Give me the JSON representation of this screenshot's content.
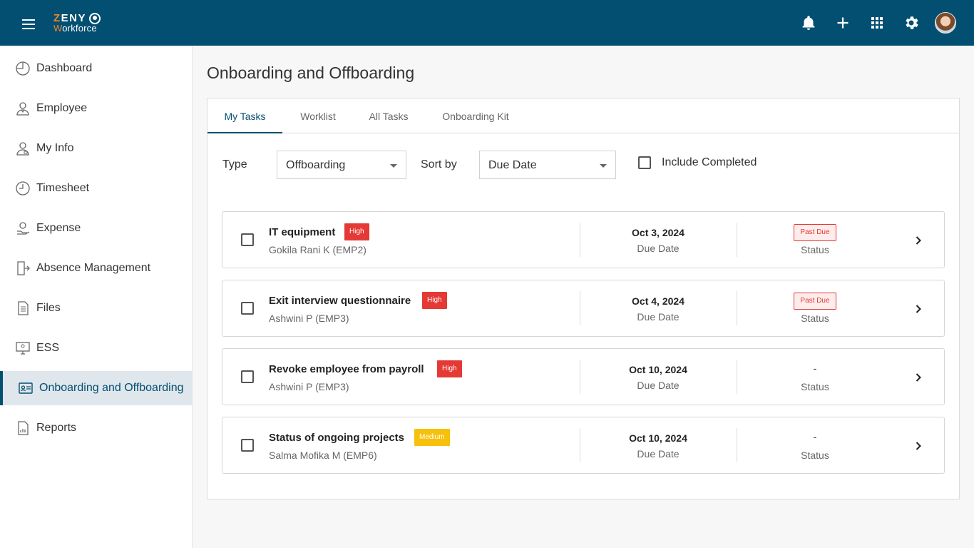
{
  "header": {
    "logo_brand": "ZENY",
    "logo_sub": "Workforce",
    "icons": [
      "menu-icon",
      "bell-icon",
      "plus-icon",
      "apps-grid-icon",
      "gear-icon",
      "avatar"
    ]
  },
  "sidebar": {
    "items": [
      {
        "label": "Dashboard",
        "icon": "dashboard-icon"
      },
      {
        "label": "Employee",
        "icon": "employee-icon"
      },
      {
        "label": "My Info",
        "icon": "my-info-icon"
      },
      {
        "label": "Timesheet",
        "icon": "clock-icon"
      },
      {
        "label": "Expense",
        "icon": "expense-icon"
      },
      {
        "label": "Absence Management",
        "icon": "exit-door-icon"
      },
      {
        "label": "Files",
        "icon": "file-icon"
      },
      {
        "label": "ESS",
        "icon": "ess-icon"
      },
      {
        "label": "Onboarding and Offboarding",
        "icon": "id-card-icon",
        "active": true
      },
      {
        "label": "Reports",
        "icon": "report-icon"
      }
    ]
  },
  "main": {
    "title": "Onboarding and Offboarding",
    "tabs": [
      {
        "label": "My Tasks",
        "active": true
      },
      {
        "label": "Worklist"
      },
      {
        "label": "All Tasks"
      },
      {
        "label": "Onboarding Kit"
      }
    ],
    "filters": {
      "type_label": "Type",
      "type_value": "Offboarding",
      "sort_label": "Sort by",
      "sort_value": "Due Date",
      "include_completed_label": "Include Completed",
      "include_completed_checked": false
    },
    "tasks": [
      {
        "name": "IT equipment",
        "priority": "High",
        "employee": "Gokila Rani K (EMP2)",
        "due_date": "Oct 3, 2024",
        "due_label": "Due Date",
        "status": "Past Due",
        "status_label": "Status"
      },
      {
        "name": "Exit interview questionnaire",
        "priority": "High",
        "employee": "Ashwini P (EMP3)",
        "due_date": "Oct 4, 2024",
        "due_label": "Due Date",
        "status": "Past Due",
        "status_label": "Status"
      },
      {
        "name": "Revoke employee from payroll",
        "priority": "High",
        "employee": "Ashwini P (EMP3)",
        "due_date": "Oct 10, 2024",
        "due_label": "Due Date",
        "status": "-",
        "status_label": "Status"
      },
      {
        "name": "Status of ongoing projects",
        "priority": "Medium",
        "employee": "Salma Mofika M (EMP6)",
        "due_date": "Oct 10, 2024",
        "due_label": "Due Date",
        "status": "-",
        "status_label": "Status"
      }
    ]
  },
  "colors": {
    "header_bg": "#034f72",
    "accent": "#034f72",
    "logo_orange": "#f0822a",
    "high": "#e53935",
    "medium": "#f7c00a",
    "past_due": "#e53935"
  }
}
